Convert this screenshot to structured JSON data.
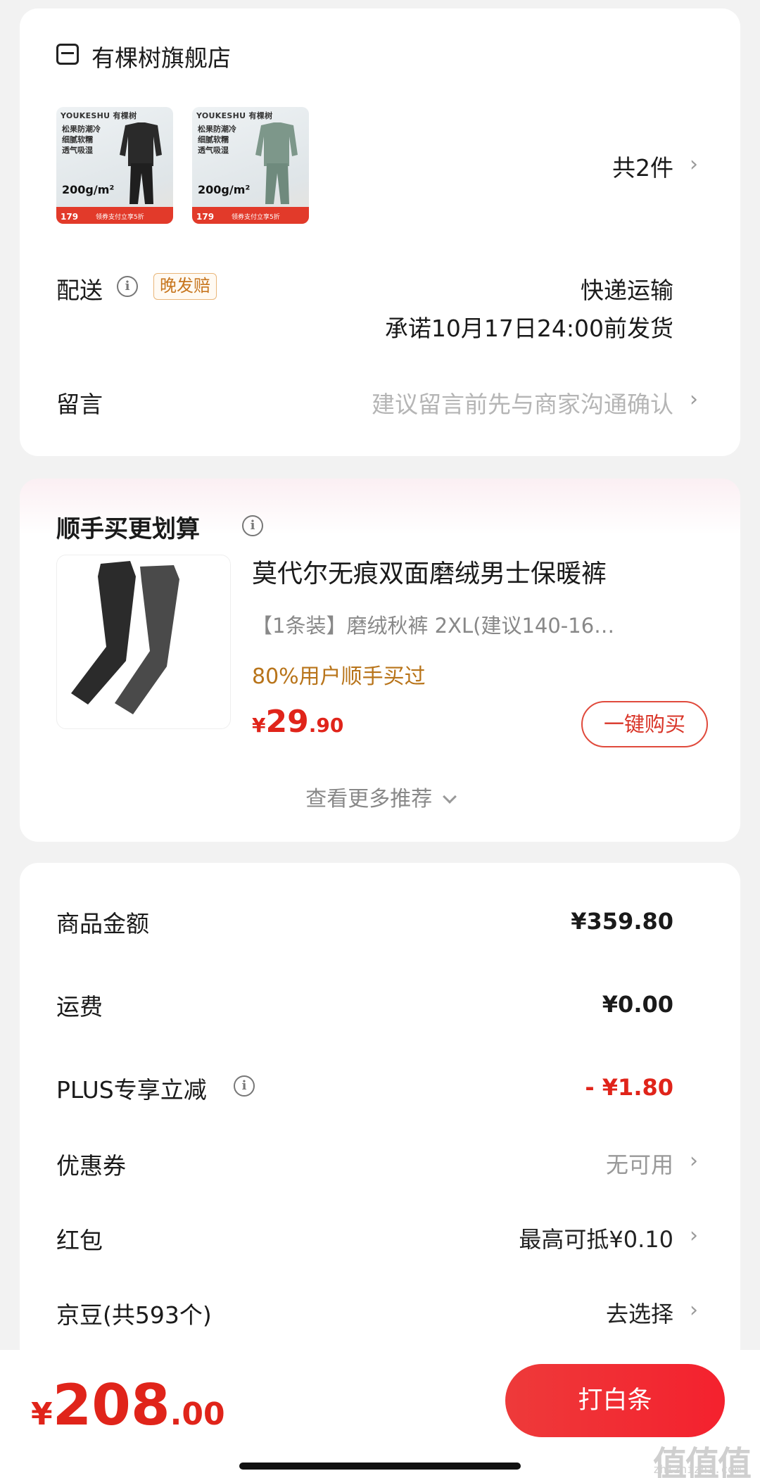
{
  "store": {
    "name": "有棵树旗舰店",
    "item_count": "共2件",
    "thumbnails": [
      {
        "brand": "YOUKESHU 有棵树",
        "lines": [
          "松果防潮冷",
          "细腻软糯",
          "透气吸湿"
        ],
        "weight": "200g/m²",
        "price": "179",
        "promo": "领券支付立享5折",
        "color": "#2a2a2a"
      },
      {
        "brand": "YOUKESHU 有棵树",
        "lines": [
          "松果防潮冷",
          "细腻软糯",
          "透气吸湿"
        ],
        "weight": "200g/m²",
        "price": "179",
        "promo": "领券支付立享5折",
        "color": "#6f8a7d"
      }
    ]
  },
  "delivery": {
    "label": "配送",
    "tag": "晚发赔",
    "method": "快递运输",
    "promise": "承诺10月17日24:00前发货"
  },
  "message": {
    "label": "留言",
    "placeholder": "建议留言前先与商家沟通确认"
  },
  "recommend": {
    "title": "顺手买更划算",
    "product_name": "莫代尔无痕双面磨绒男士保暖裤",
    "spec": "【1条装】磨绒秋裤   2XL(建议140-16…",
    "buyers": "80%用户顺手买过",
    "price_symbol": "¥",
    "price_int": "29",
    "price_dec": ".90",
    "buy_label": "一键购买",
    "more_label": "查看更多推荐"
  },
  "fees": {
    "goods_label": "商品金额",
    "goods_value": "¥359.80",
    "shipping_label": "运费",
    "shipping_value": "¥0.00",
    "plus_label": "PLUS专享立减",
    "plus_value": "- ¥1.80",
    "coupon_label": "优惠券",
    "coupon_value": "无可用",
    "redpacket_label": "红包",
    "redpacket_value": "最高可抵¥0.10",
    "jingdou_label": "京豆(共593个)",
    "jingdou_value": "去选择"
  },
  "bottom": {
    "symbol": "¥",
    "total_int": "208",
    "total_dec": ".00",
    "pay_label": "打白条",
    "watermark": "值值值",
    "watermark_url": "zhizhizhi.com"
  }
}
